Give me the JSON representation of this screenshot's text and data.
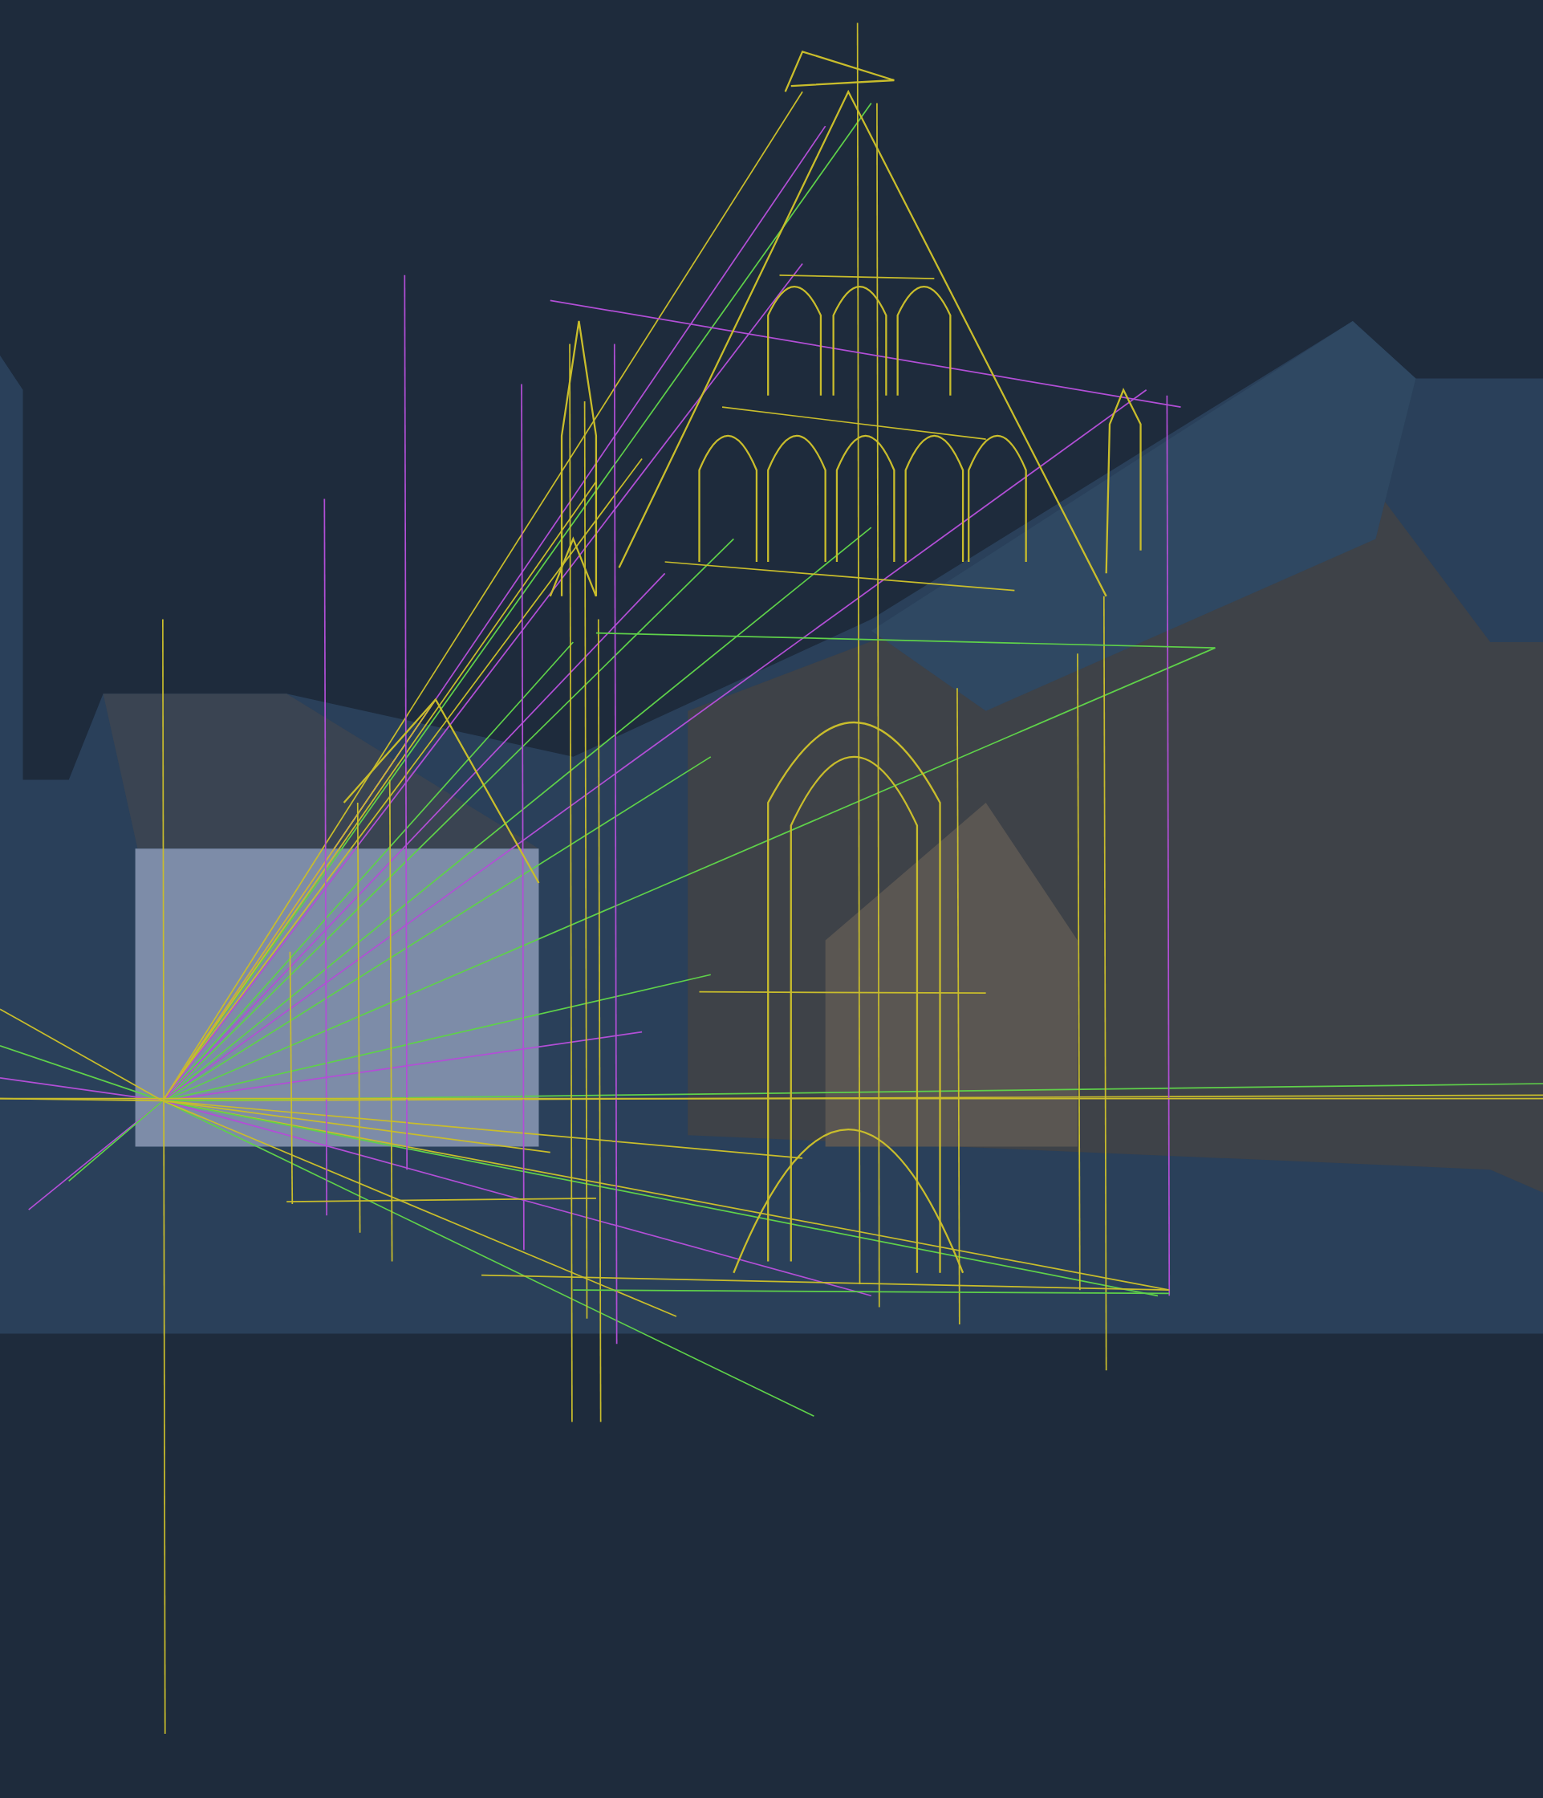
{
  "scene": {
    "kind": "perspective-sketch"
  }
}
